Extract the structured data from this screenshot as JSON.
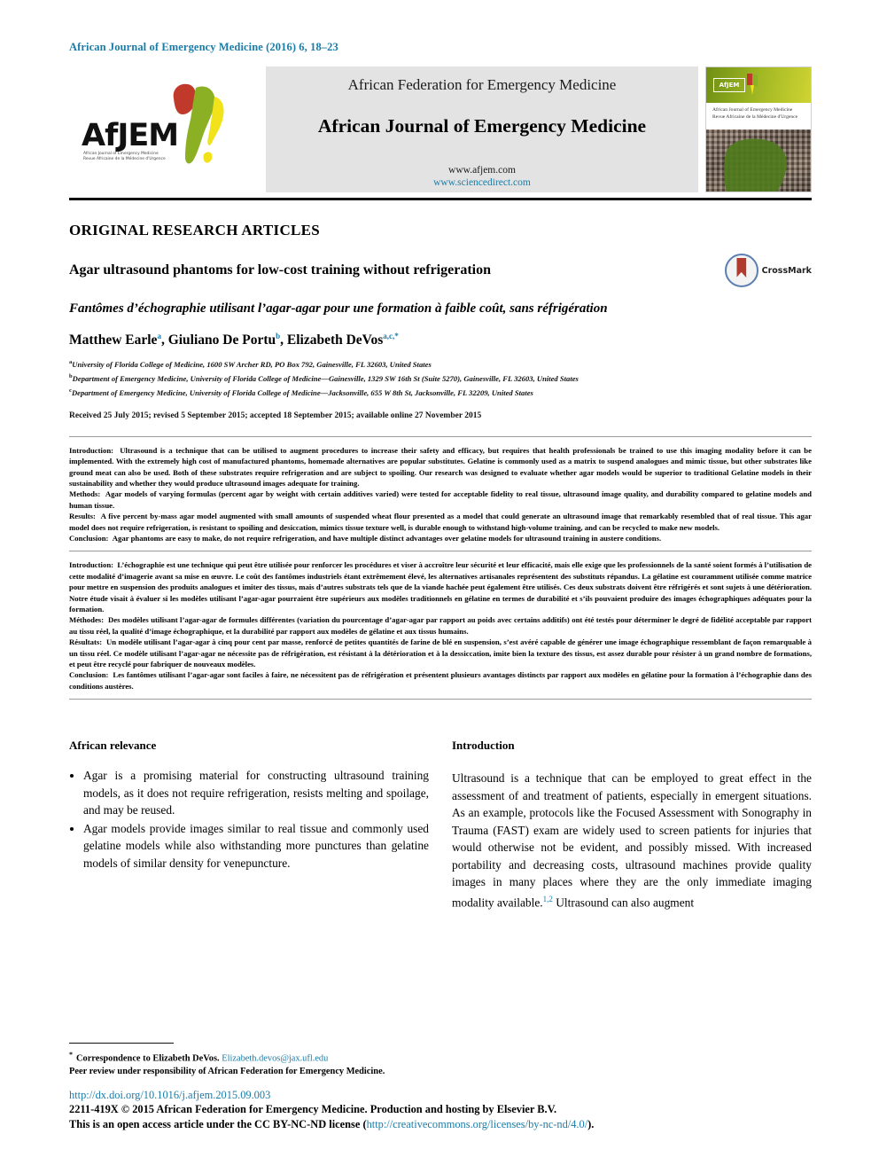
{
  "running_head": "African Journal of Emergency Medicine (2016) 6, 18–23",
  "masthead": {
    "logo_word": "AfJEM",
    "logo_sub": "African Journal of Emergency Medicine\nRevue Africaine de la Médecine d'Urgence",
    "federation": "African Federation for Emergency Medicine",
    "journal": "African Journal of Emergency Medicine",
    "url_plain": "www.afjem.com",
    "url_link": "www.sciencedirect.com",
    "cover": {
      "badge": "AfJEM",
      "title_line1": "African Journal of Emergency Medicine",
      "title_line2": "Revue Africaine de la Médecine d'Urgence"
    }
  },
  "article": {
    "section_label": "ORIGINAL RESEARCH ARTICLES",
    "title_en": "Agar ultrasound phantoms for low-cost training without refrigeration",
    "title_fr": "Fantômes d’échographie utilisant l’agar-agar pour une formation à faible coût, sans réfrigération",
    "crossmark_label": "CrossMark",
    "authors_html": "Matthew Earle, Giuliano De Portu, Elizabeth DeVos",
    "author_1": "Matthew Earle",
    "author_1_mark": "a",
    "author_2": "Giuliano De Portu",
    "author_2_mark": "b",
    "author_3": "Elizabeth DeVos",
    "author_3_mark": "a,c,*",
    "affiliations": [
      {
        "mark": "a",
        "text": "University of Florida College of Medicine, 1600 SW Archer RD, PO Box 792, Gainesville, FL 32603, United States"
      },
      {
        "mark": "b",
        "text": "Department of Emergency Medicine, University of Florida College of Medicine—Gainesville, 1329 SW 16th St (Suite 5270), Gainesville, FL 32603, United States"
      },
      {
        "mark": "c",
        "text": "Department of Emergency Medicine, University of Florida College of Medicine—Jacksonville, 655 W 8th St, Jacksonville, FL 32209, United States"
      }
    ],
    "received": "Received 25 July 2015; revised 5 September 2015; accepted 18 September 2015; available online 27 November 2015"
  },
  "abstract_en": {
    "introduction_label": "Introduction:",
    "introduction_text": "Ultrasound is a technique that can be utilised to augment procedures to increase their safety and efficacy, but requires that health professionals be trained to use this imaging modality before it can be implemented. With the extremely high cost of manufactured phantoms, homemade alternatives are popular substitutes. Gelatine is commonly used as a matrix to suspend analogues and mimic tissue, but other substrates like ground meat can also be used. Both of these substrates require refrigeration and are subject to spoiling. Our research was designed to evaluate whether agar models would be superior to traditional Gelatine models in their sustainability and whether they would produce ultrasound images adequate for training.",
    "methods_label": "Methods:",
    "methods_text": "Agar models of varying formulas (percent agar by weight with certain additives varied) were tested for acceptable fidelity to real tissue, ultrasound image quality, and durability compared to gelatine models and human tissue.",
    "results_label": "Results:",
    "results_text": "A five percent by-mass agar model augmented with small amounts of suspended wheat flour presented as a model that could generate an ultrasound image that remarkably resembled that of real tissue. This agar model does not require refrigeration, is resistant to spoiling and desiccation, mimics tissue texture well, is durable enough to withstand high-volume training, and can be recycled to make new models.",
    "conclusion_label": "Conclusion:",
    "conclusion_text": "Agar phantoms are easy to make, do not require refrigeration, and have multiple distinct advantages over gelatine models for ultrasound training in austere conditions."
  },
  "abstract_fr": {
    "introduction_label": "Introduction:",
    "introduction_text": "L’échographie est une technique qui peut être utilisée pour renforcer les procédures et viser à accroître leur sécurité et leur efficacité, mais elle exige que les professionnels de la santé soient formés à l’utilisation de cette modalité d’imagerie avant sa mise en œuvre. Le coût des fantômes industriels étant extrêmement élevé, les alternatives artisanales représentent des substituts répandus. La gélatine est couramment utilisée comme matrice pour mettre en suspension des produits analogues et imiter des tissus, mais d’autres substrats tels que de la viande hachée peut également être utilisés. Ces deux substrats doivent être réfrigérés et sont sujets à une détérioration. Notre étude visait à évaluer si les modèles utilisant l’agar-agar pourraient être supérieurs aux modèles traditionnels en gélatine en termes de durabilité et s’ils pouvaient produire des images échographiques adéquates pour la formation.",
    "methods_label": "Méthodes:",
    "methods_text": "Des modèles utilisant l’agar-agar de formules différentes (variation du pourcentage d’agar-agar par rapport au poids avec certains additifs) ont été testés pour déterminer le degré de fidélité acceptable par rapport au tissu réel, la qualité d’image échographique, et la durabilité par rapport aux modèles de gélatine et aux tissus humains.",
    "results_label": "Résultats:",
    "results_text": "Un modèle utilisant l’agar-agar à cinq pour cent par masse, renforcé de petites quantités de farine de blé en suspension, s’est avéré capable de générer une image échographique ressemblant de façon remarquable à un tissu réel. Ce modèle utilisant l’agar-agar ne nécessite pas de réfrigération, est résistant à la détérioration et à la dessiccation, imite bien la texture des tissus, est assez durable pour résister à un grand nombre de formations, et peut être recyclé pour fabriquer de nouveaux modèles.",
    "conclusion_label": "Conclusion:",
    "conclusion_text": "Les fantômes utilisant l’agar-agar sont faciles à faire, ne nécessitent pas de réfrigération et présentent plusieurs avantages distincts par rapport aux modèles en gélatine pour la formation à l’échographie dans des conditions austères."
  },
  "african_relevance": {
    "heading": "African relevance",
    "bullets": [
      "Agar is a promising material for constructing ultrasound training models, as it does not require refrigeration, resists melting and spoilage, and may be reused.",
      "Agar models provide images similar to real tissue and commonly used gelatine models while also withstanding more punctures than gelatine models of similar density for venepuncture."
    ]
  },
  "introduction": {
    "heading": "Introduction",
    "paragraph_part1": "Ultrasound is a technique that can be employed to great effect in the assessment of and treatment of patients, especially in emergent situations. As an example, protocols like the Focused Assessment with Sonography in Trauma (FAST) exam are widely used to screen patients for injuries that would otherwise not be evident, and possibly missed. With increased portability and decreasing costs, ultrasound machines provide quality images in many places where they are the only immediate imaging modality available.",
    "reference_marker": "1,2",
    "paragraph_part2": "Ultrasound can also augment"
  },
  "footer": {
    "correspondence_star": "*",
    "correspondence_label": "Correspondence to Elizabeth DeVos.",
    "correspondence_email": "Elizabeth.devos@jax.ufl.edu",
    "peer_review": "Peer review under responsibility of African Federation for Emergency Medicine.",
    "doi": "http://dx.doi.org/10.1016/j.afjem.2015.09.003",
    "copyright_line1": "2211-419X © 2015 African Federation for Emergency Medicine. Production and hosting by Elsevier B.V.",
    "license_prefix": "This is an open access article under the CC BY-NC-ND license (",
    "license_url": "http://creativecommons.org/licenses/by-nc-nd/4.0/",
    "license_suffix": ")."
  },
  "colors": {
    "accent_blue": "#1b7ca8",
    "masthead_grey": "#e3e3e3",
    "logo_red": "#c0392b",
    "logo_green": "#8cb024",
    "logo_yellow": "#f2e21a"
  }
}
